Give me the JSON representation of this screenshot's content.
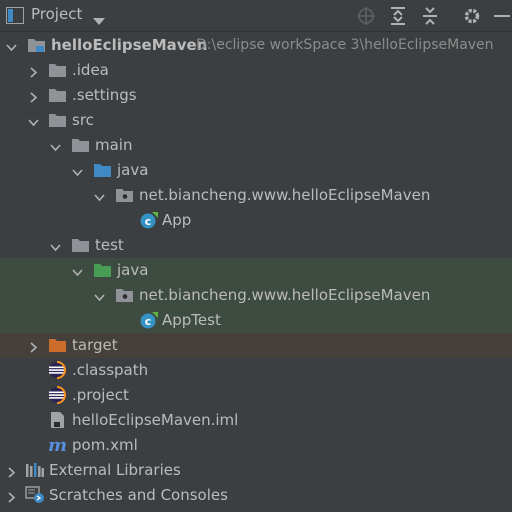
{
  "toolbar": {
    "title": "Project",
    "icons": [
      "target-icon",
      "expand-all-icon",
      "collapse-all-icon",
      "gear-icon",
      "minimize-icon"
    ]
  },
  "tree": {
    "root": {
      "label": "helloEclipseMaven",
      "path": "D:\\eclipse workSpace 3\\helloEclipseMaven"
    },
    "idea": ".idea",
    "settings": ".settings",
    "src": "src",
    "main": "main",
    "main_java": "java",
    "main_pkg": "net.biancheng.www.helloEclipseMaven",
    "app": "App",
    "test": "test",
    "test_java": "java",
    "test_pkg": "net.biancheng.www.helloEclipseMaven",
    "apptest": "AppTest",
    "target": "target",
    "classpath": ".classpath",
    "project": ".project",
    "iml": "helloEclipseMaven.iml",
    "pom": "pom.xml",
    "ext_libs": "External Libraries",
    "scratches": "Scratches and Consoles"
  },
  "colors": {
    "background": "#3c3f41",
    "test_highlight": "#3e4b40",
    "excluded_highlight": "#45403a",
    "folder_gray": "#8f9297",
    "folder_blue": "#3f8ac4",
    "folder_green": "#499c54",
    "folder_orange": "#cc6d2e"
  }
}
